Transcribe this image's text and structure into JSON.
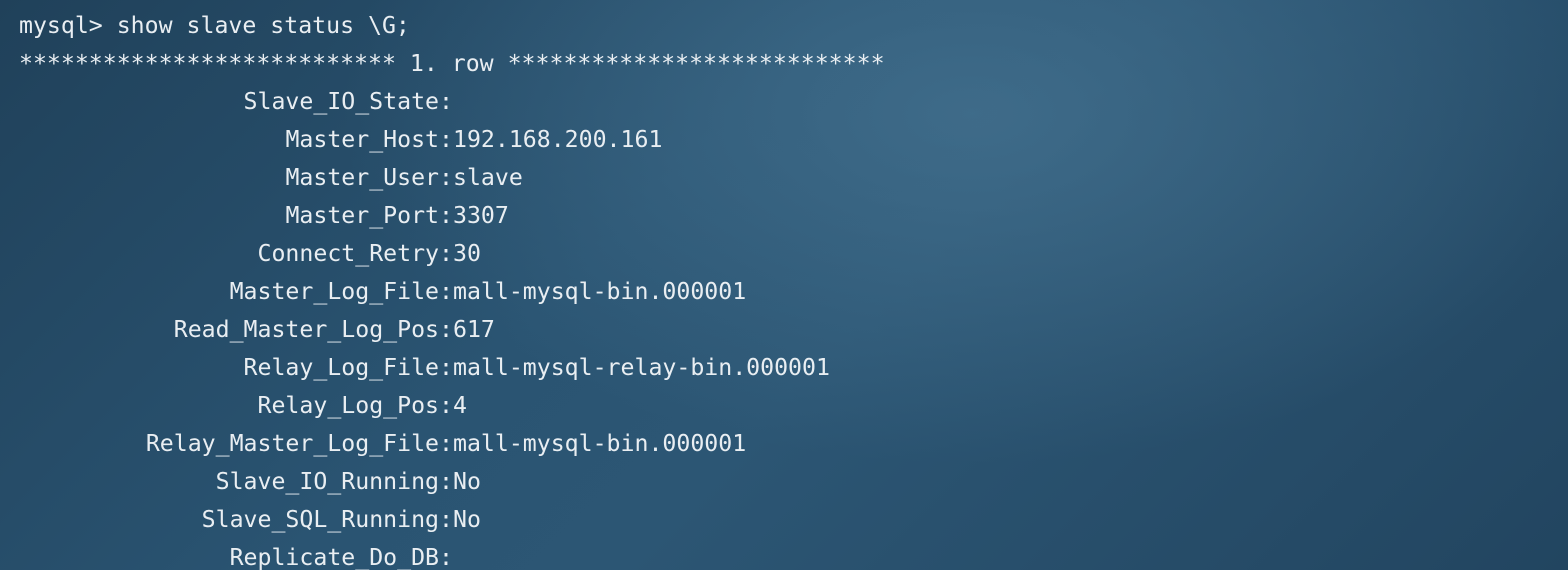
{
  "terminal": {
    "prompt": "mysql> show slave status \\G;",
    "row_header": "*************************** 1. row ***************************",
    "fields": [
      {
        "name": "Slave_IO_State",
        "value": ""
      },
      {
        "name": "Master_Host",
        "value": "192.168.200.161"
      },
      {
        "name": "Master_User",
        "value": "slave"
      },
      {
        "name": "Master_Port",
        "value": "3307"
      },
      {
        "name": "Connect_Retry",
        "value": "30"
      },
      {
        "name": "Master_Log_File",
        "value": "mall-mysql-bin.000001"
      },
      {
        "name": "Read_Master_Log_Pos",
        "value": "617"
      },
      {
        "name": "Relay_Log_File",
        "value": "mall-mysql-relay-bin.000001"
      },
      {
        "name": "Relay_Log_Pos",
        "value": "4"
      },
      {
        "name": "Relay_Master_Log_File",
        "value": "mall-mysql-bin.000001"
      },
      {
        "name": "Slave_IO_Running",
        "value": "No"
      },
      {
        "name": "Slave_SQL_Running",
        "value": "No"
      },
      {
        "name": "Replicate_Do_DB",
        "value": ""
      }
    ]
  }
}
